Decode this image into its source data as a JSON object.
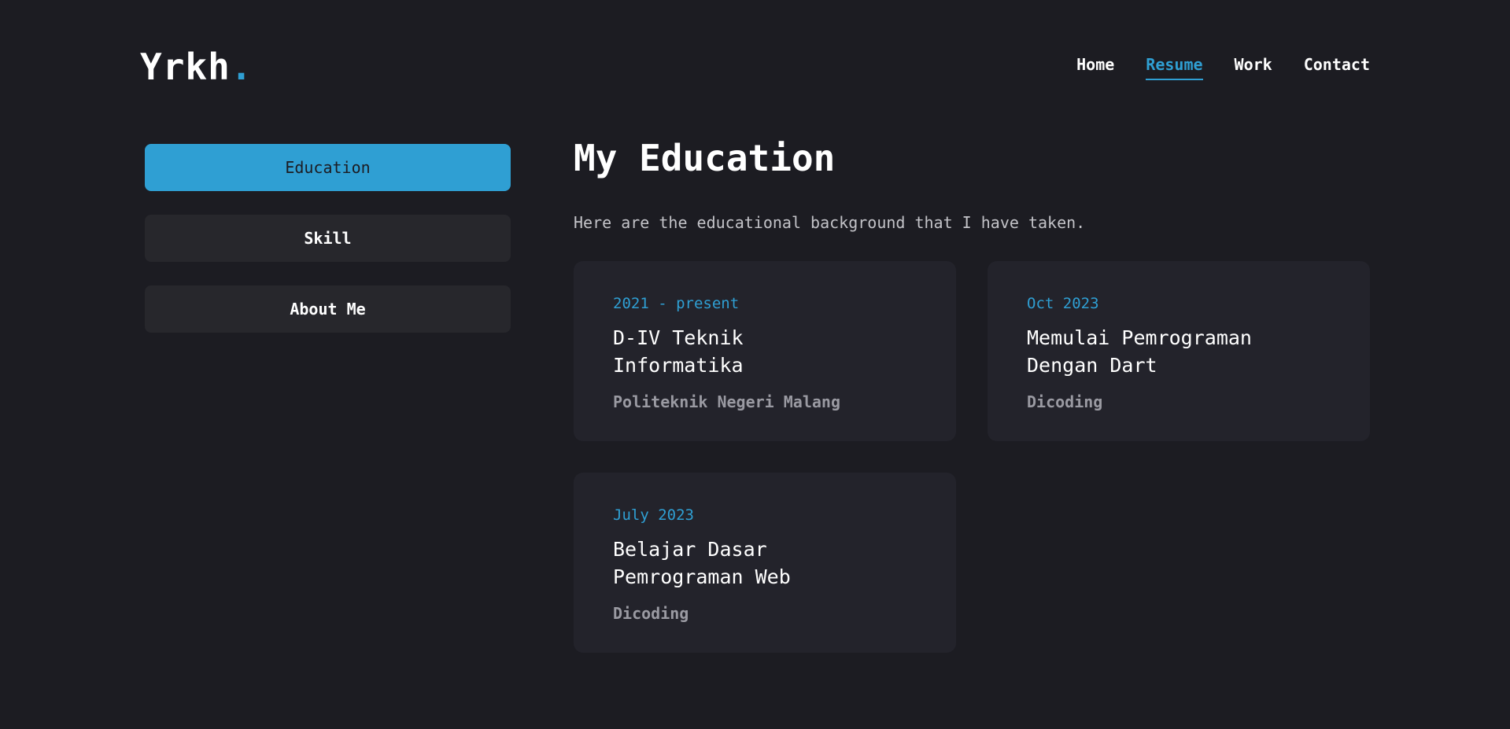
{
  "header": {
    "logo_text": "Yrkh",
    "logo_dot": ".",
    "nav": [
      {
        "label": "Home",
        "active": false
      },
      {
        "label": "Resume",
        "active": true
      },
      {
        "label": "Work",
        "active": false
      },
      {
        "label": "Contact",
        "active": false
      }
    ]
  },
  "sidebar": {
    "tabs": [
      {
        "label": "Education",
        "active": true
      },
      {
        "label": "Skill",
        "active": false
      },
      {
        "label": "About Me",
        "active": false
      }
    ]
  },
  "main": {
    "title": "My Education",
    "description": "Here are the educational background that I have taken.",
    "cards": [
      {
        "date": "2021 - present",
        "title": "D-IV Teknik Informatika",
        "org": "Politeknik Negeri Malang"
      },
      {
        "date": "Oct 2023",
        "title": "Memulai Pemrograman Dengan Dart",
        "org": "Dicoding"
      },
      {
        "date": "July 2023",
        "title": "Belajar Dasar Pemrograman Web",
        "org": "Dicoding"
      }
    ]
  },
  "colors": {
    "background": "#1c1c22",
    "accent": "#2f9fd3",
    "card": "#23232b",
    "tab": "#27272c"
  }
}
